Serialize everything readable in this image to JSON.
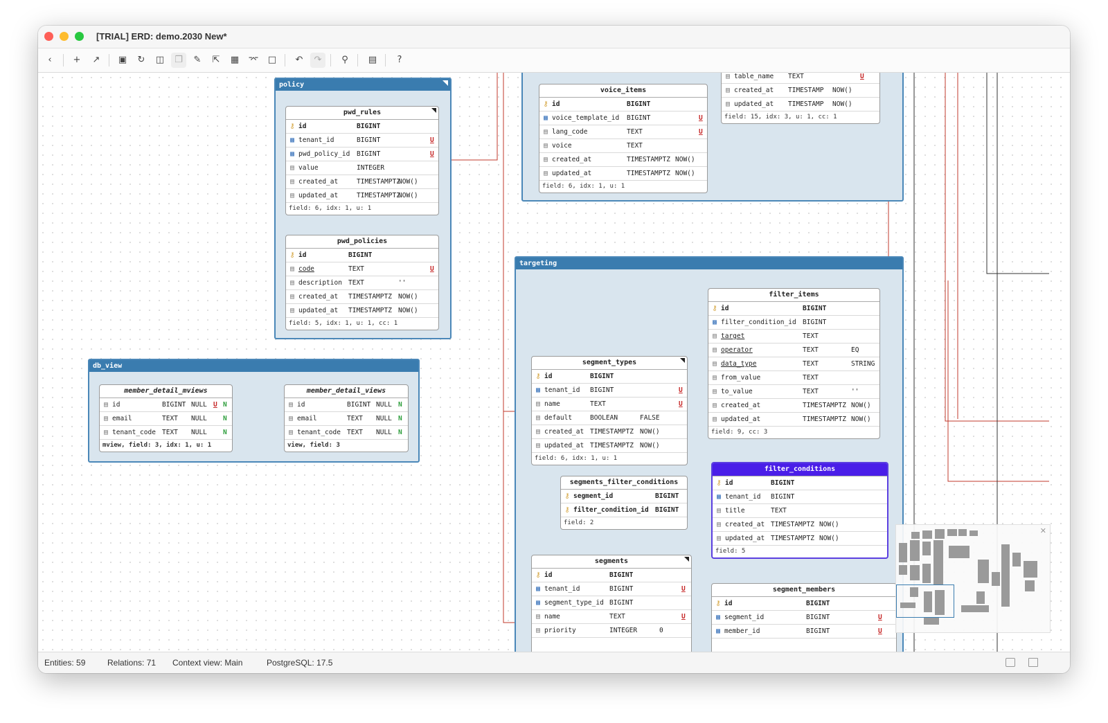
{
  "window": {
    "title": "[TRIAL] ERD: demo.2030 New*"
  },
  "toolbar": {
    "icons": [
      "back-icon",
      "add-icon",
      "link-icon",
      "save-icon",
      "refresh-icon",
      "table-icon",
      "copy-icon",
      "edit-icon",
      "export-icon",
      "grid-icon",
      "share-icon",
      "folder-icon",
      "undo-icon",
      "redo-icon",
      "search-icon",
      "document-icon",
      "help-icon"
    ]
  },
  "groups": {
    "policy": "policy",
    "db_view": "db_view",
    "targeting": "targeting"
  },
  "tables": {
    "pwd_rules": {
      "name": "pwd_rules",
      "rows": [
        {
          "name": "id",
          "type": "BIGINT",
          "def": "",
          "flag": ""
        },
        {
          "name": "tenant_id",
          "type": "BIGINT",
          "def": "",
          "flag": "U"
        },
        {
          "name": "pwd_policy_id",
          "type": "BIGINT",
          "def": "",
          "flag": "U"
        },
        {
          "name": "value",
          "type": "INTEGER",
          "def": "",
          "flag": ""
        },
        {
          "name": "created_at",
          "type": "TIMESTAMPTZ",
          "def": "NOW()",
          "flag": ""
        },
        {
          "name": "updated_at",
          "type": "TIMESTAMPTZ",
          "def": "NOW()",
          "flag": ""
        }
      ],
      "footer": "field: 6, idx: 1, u: 1"
    },
    "pwd_policies": {
      "name": "pwd_policies",
      "rows": [
        {
          "name": "id",
          "type": "BIGINT",
          "def": "",
          "flag": ""
        },
        {
          "name": "code",
          "type": "TEXT",
          "def": "",
          "flag": "U"
        },
        {
          "name": "description",
          "type": "TEXT",
          "def": "''",
          "flag": ""
        },
        {
          "name": "created_at",
          "type": "TIMESTAMPTZ",
          "def": "NOW()",
          "flag": ""
        },
        {
          "name": "updated_at",
          "type": "TIMESTAMPTZ",
          "def": "NOW()",
          "flag": ""
        }
      ],
      "footer": "field: 5, idx: 1, u: 1, cc: 1"
    },
    "voice_items": {
      "name": "voice_items",
      "rows": [
        {
          "name": "id",
          "type": "BIGINT",
          "def": "",
          "flag": ""
        },
        {
          "name": "voice_template_id",
          "type": "BIGINT",
          "def": "",
          "flag": "U"
        },
        {
          "name": "lang_code",
          "type": "TEXT",
          "def": "",
          "flag": "U"
        },
        {
          "name": "voice",
          "type": "TEXT",
          "def": "",
          "flag": ""
        },
        {
          "name": "created_at",
          "type": "TIMESTAMPTZ",
          "def": "NOW()",
          "flag": ""
        },
        {
          "name": "updated_at",
          "type": "TIMESTAMPTZ",
          "def": "NOW()",
          "flag": ""
        }
      ],
      "footer": "field: 6, idx: 1, u: 1"
    },
    "partial_top": {
      "rows": [
        {
          "name": "table_name",
          "type": "TEXT",
          "def": "",
          "flag": "U"
        },
        {
          "name": "created_at",
          "type": "TIMESTAMP",
          "def": "NOW()",
          "flag": ""
        },
        {
          "name": "updated_at",
          "type": "TIMESTAMP",
          "def": "NOW()",
          "flag": ""
        }
      ],
      "footer": "field: 15, idx: 3, u: 1, cc: 1"
    },
    "member_detail_mviews": {
      "name": "member_detail_mviews",
      "rows": [
        {
          "name": "id",
          "type": "BIGINT",
          "null": "NULL",
          "u": "U",
          "n": "N"
        },
        {
          "name": "email",
          "type": "TEXT",
          "null": "NULL",
          "u": "",
          "n": "N"
        },
        {
          "name": "tenant_code",
          "type": "TEXT",
          "null": "NULL",
          "u": "",
          "n": "N"
        }
      ],
      "footer": "mview, field: 3, idx: 1, u: 1"
    },
    "member_detail_views": {
      "name": "member_detail_views",
      "rows": [
        {
          "name": "id",
          "type": "BIGINT",
          "null": "NULL",
          "u": "",
          "n": "N"
        },
        {
          "name": "email",
          "type": "TEXT",
          "null": "NULL",
          "u": "",
          "n": "N"
        },
        {
          "name": "tenant_code",
          "type": "TEXT",
          "null": "NULL",
          "u": "",
          "n": "N"
        }
      ],
      "footer": "view, field: 3"
    },
    "filter_items": {
      "name": "filter_items",
      "rows": [
        {
          "name": "id",
          "type": "BIGINT",
          "def": "",
          "flag": ""
        },
        {
          "name": "filter_condition_id",
          "type": "BIGINT",
          "def": "",
          "flag": ""
        },
        {
          "name": "target",
          "type": "TEXT",
          "def": "",
          "flag": ""
        },
        {
          "name": "operator",
          "type": "TEXT",
          "def": "EQ",
          "flag": ""
        },
        {
          "name": "data_type",
          "type": "TEXT",
          "def": "STRING",
          "flag": ""
        },
        {
          "name": "from_value",
          "type": "TEXT",
          "def": "",
          "flag": ""
        },
        {
          "name": "to_value",
          "type": "TEXT",
          "def": "''",
          "flag": ""
        },
        {
          "name": "created_at",
          "type": "TIMESTAMPTZ",
          "def": "NOW()",
          "flag": ""
        },
        {
          "name": "updated_at",
          "type": "TIMESTAMPTZ",
          "def": "NOW()",
          "flag": ""
        }
      ],
      "footer": "field: 9, cc: 3"
    },
    "segment_types": {
      "name": "segment_types",
      "rows": [
        {
          "name": "id",
          "type": "BIGINT",
          "def": "",
          "flag": ""
        },
        {
          "name": "tenant_id",
          "type": "BIGINT",
          "def": "",
          "flag": "U"
        },
        {
          "name": "name",
          "type": "TEXT",
          "def": "",
          "flag": "U"
        },
        {
          "name": "default",
          "type": "BOOLEAN",
          "def": "FALSE",
          "flag": ""
        },
        {
          "name": "created_at",
          "type": "TIMESTAMPTZ",
          "def": "NOW()",
          "flag": ""
        },
        {
          "name": "updated_at",
          "type": "TIMESTAMPTZ",
          "def": "NOW()",
          "flag": ""
        }
      ],
      "footer": "field: 6, idx: 1, u: 1"
    },
    "filter_conditions": {
      "name": "filter_conditions",
      "rows": [
        {
          "name": "id",
          "type": "BIGINT",
          "def": "",
          "flag": ""
        },
        {
          "name": "tenant_id",
          "type": "BIGINT",
          "def": "",
          "flag": ""
        },
        {
          "name": "title",
          "type": "TEXT",
          "def": "",
          "flag": ""
        },
        {
          "name": "created_at",
          "type": "TIMESTAMPTZ",
          "def": "NOW()",
          "flag": ""
        },
        {
          "name": "updated_at",
          "type": "TIMESTAMPTZ",
          "def": "NOW()",
          "flag": ""
        }
      ],
      "footer": "field: 5"
    },
    "segments_filter_conditions": {
      "name": "segments_filter_conditions",
      "rows": [
        {
          "name": "segment_id",
          "type": "BIGINT",
          "def": "",
          "flag": ""
        },
        {
          "name": "filter_condition_id",
          "type": "BIGINT",
          "def": "",
          "flag": ""
        }
      ],
      "footer": "field: 2"
    },
    "segments": {
      "name": "segments",
      "rows": [
        {
          "name": "id",
          "type": "BIGINT",
          "def": "",
          "flag": ""
        },
        {
          "name": "tenant_id",
          "type": "BIGINT",
          "def": "",
          "flag": "U"
        },
        {
          "name": "segment_type_id",
          "type": "BIGINT",
          "def": "",
          "flag": ""
        },
        {
          "name": "name",
          "type": "TEXT",
          "def": "",
          "flag": "U"
        },
        {
          "name": "priority",
          "type": "INTEGER",
          "def": "0",
          "flag": ""
        }
      ]
    },
    "segment_members": {
      "name": "segment_members",
      "rows": [
        {
          "name": "id",
          "type": "BIGINT",
          "def": "",
          "flag": ""
        },
        {
          "name": "segment_id",
          "type": "BIGINT",
          "def": "",
          "flag": "U"
        },
        {
          "name": "member_id",
          "type": "BIGINT",
          "def": "",
          "flag": "U"
        }
      ]
    }
  },
  "statusbar": {
    "entities": "Entities: 59",
    "relations": "Relations: 71",
    "context": "Context view: Main",
    "db": "PostgreSQL: 17.5"
  },
  "colors": {
    "group_header": "#3a7caf",
    "selected_table": "#4a1ee8",
    "relation_line": "#c0392b",
    "fk_icon": "#4a7fc1",
    "pk_icon": "#d4a23a"
  }
}
